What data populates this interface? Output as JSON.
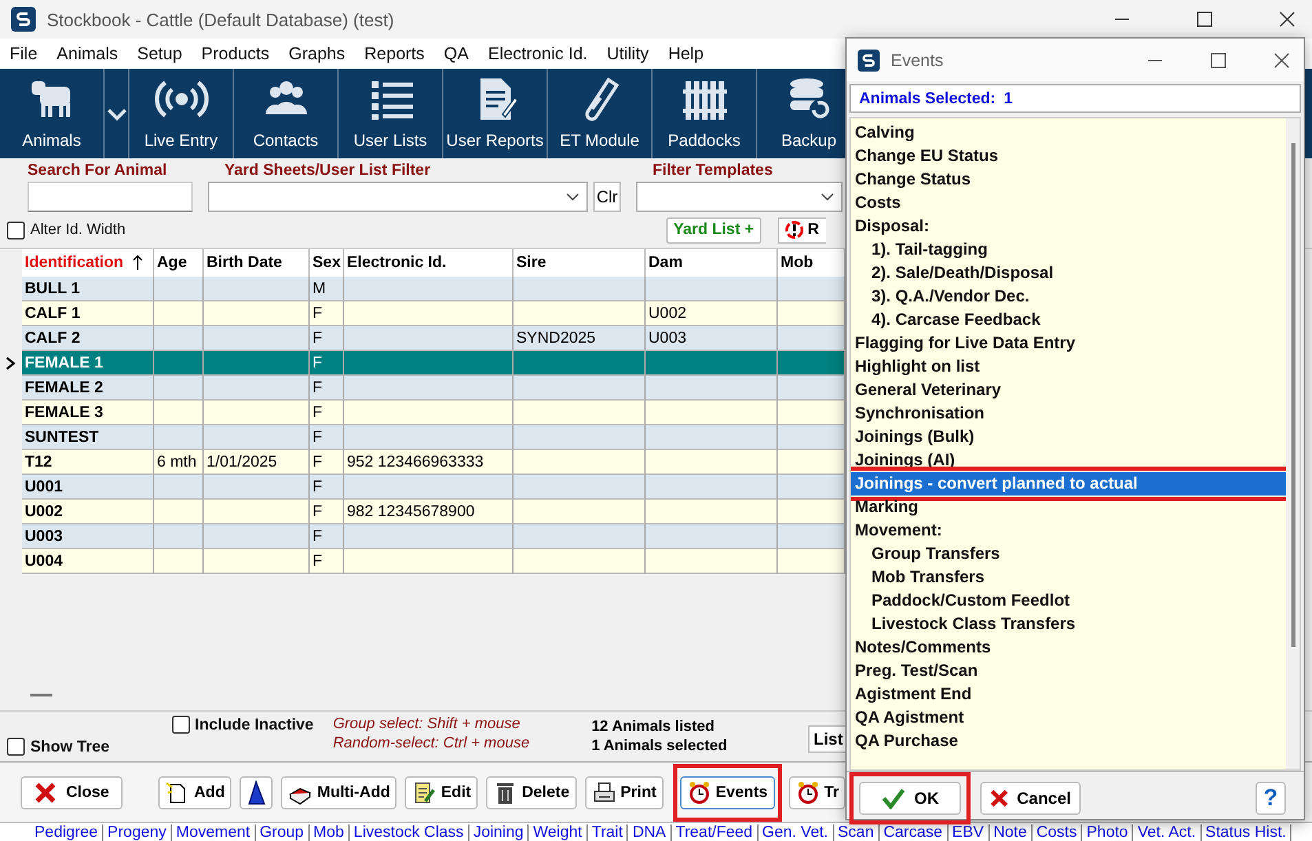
{
  "window": {
    "title": "Stockbook - Cattle (Default Database) (test)"
  },
  "menu": [
    "File",
    "Animals",
    "Setup",
    "Products",
    "Graphs",
    "Reports",
    "QA",
    "Electronic Id.",
    "Utility",
    "Help"
  ],
  "toolbar": [
    {
      "label": "Animals",
      "kind": "cow"
    },
    {
      "label": "Live Entry",
      "kind": "broadcast"
    },
    {
      "label": "Contacts",
      "kind": "people"
    },
    {
      "label": "User Lists",
      "kind": "list"
    },
    {
      "label": "User Reports",
      "kind": "document"
    },
    {
      "label": "ET Module",
      "kind": "tube"
    },
    {
      "label": "Paddocks",
      "kind": "fence"
    },
    {
      "label": "Backup",
      "kind": "database"
    }
  ],
  "filters": {
    "search_label": "Search For Animal",
    "yard_label": "Yard Sheets/User List Filter",
    "clear_button": "Clr",
    "templates_label": "Filter Templates",
    "alter_id_width": {
      "label": "Alter Id. Width",
      "checked": false
    },
    "yard_list_button": "Yard List +",
    "cut_button": "R"
  },
  "table": {
    "columns": [
      {
        "label": "Identification",
        "sorted": true
      },
      {
        "label": "Age",
        "sorted": false
      },
      {
        "label": "Birth Date",
        "sorted": false
      },
      {
        "label": "Sex",
        "sorted": false
      },
      {
        "label": "Electronic Id.",
        "sorted": false
      },
      {
        "label": "Sire",
        "sorted": false
      },
      {
        "label": "Dam",
        "sorted": false
      },
      {
        "label": "Mob",
        "sorted": false
      }
    ],
    "rows": [
      {
        "cells": [
          "BULL 1",
          null,
          null,
          "M",
          null,
          null,
          null,
          null
        ],
        "selected": false
      },
      {
        "cells": [
          "CALF 1",
          null,
          null,
          "F",
          null,
          null,
          "U002",
          null
        ],
        "selected": false
      },
      {
        "cells": [
          "CALF 2",
          null,
          null,
          "F",
          null,
          "SYND2025",
          "U003",
          null
        ],
        "selected": false
      },
      {
        "cells": [
          "FEMALE 1",
          null,
          null,
          "F",
          null,
          null,
          null,
          null
        ],
        "selected": true
      },
      {
        "cells": [
          "FEMALE 2",
          null,
          null,
          "F",
          null,
          null,
          null,
          null
        ],
        "selected": false
      },
      {
        "cells": [
          "FEMALE 3",
          null,
          null,
          "F",
          null,
          null,
          null,
          null
        ],
        "selected": false
      },
      {
        "cells": [
          "SUNTEST",
          null,
          null,
          "F",
          null,
          null,
          null,
          null
        ],
        "selected": false
      },
      {
        "cells": [
          "T12",
          "6 mth",
          "1/01/2025",
          "F",
          "952 123466963333",
          null,
          null,
          null
        ],
        "selected": false
      },
      {
        "cells": [
          "U001",
          null,
          null,
          "F",
          null,
          null,
          null,
          null
        ],
        "selected": false
      },
      {
        "cells": [
          "U002",
          null,
          null,
          "F",
          "982 12345678900",
          null,
          null,
          null
        ],
        "selected": false
      },
      {
        "cells": [
          "U003",
          null,
          null,
          "F",
          null,
          null,
          null,
          null
        ],
        "selected": false
      },
      {
        "cells": [
          "U004",
          null,
          null,
          "F",
          null,
          null,
          null,
          null
        ],
        "selected": false
      }
    ]
  },
  "options": {
    "include_inactive": {
      "label": "Include Inactive",
      "checked": false
    },
    "show_tree": {
      "label": "Show Tree",
      "checked": false
    },
    "hints": [
      "Group select: Shift + mouse",
      "Random-select: Ctrl + mouse"
    ],
    "counts": [
      "12 Animals listed",
      "1 Animals selected"
    ],
    "list_button": "List"
  },
  "buttons": [
    {
      "label": "Close",
      "kind": "close",
      "highlighted": false
    },
    {
      "label": "Add",
      "kind": "add",
      "highlighted": false
    },
    {
      "kind": "cone",
      "highlighted": false
    },
    {
      "label": "Multi-Add",
      "kind": "multi",
      "highlighted": false
    },
    {
      "label": "Edit",
      "kind": "edit",
      "highlighted": false
    },
    {
      "label": "Delete",
      "kind": "delete",
      "highlighted": false
    },
    {
      "label": "Print",
      "kind": "print",
      "highlighted": false
    },
    {
      "label": "Events",
      "kind": "clock",
      "highlighted": true
    },
    {
      "label": "Tr",
      "kind": "clock",
      "highlighted": false
    }
  ],
  "links": [
    "Pedigree",
    "Progeny",
    "Movement",
    "Group",
    "Mob",
    "Livestock Class",
    "Joining",
    "Weight",
    "Trait",
    "DNA",
    "Treat/Feed",
    "Gen. Vet.",
    "Scan",
    "Carcase",
    "EBV",
    "Note",
    "Costs",
    "Photo",
    "Vet. Act.",
    "Status Hist."
  ],
  "events_dialog": {
    "title": "Events",
    "selected_label": "Animals Selected:",
    "selected_count": "1",
    "items": [
      {
        "label": "Calving",
        "selected": false,
        "highlighted": false
      },
      {
        "label": "Change EU Status",
        "selected": false,
        "highlighted": false
      },
      {
        "label": "Change Status",
        "selected": false,
        "highlighted": false
      },
      {
        "label": "Costs",
        "selected": false,
        "highlighted": false
      },
      {
        "label": "Disposal:",
        "selected": false,
        "highlighted": false,
        "children": [
          {
            "label": "1). Tail-tagging",
            "selected": false,
            "highlighted": false
          },
          {
            "label": "2). Sale/Death/Disposal",
            "selected": false,
            "highlighted": false
          },
          {
            "label": "3). Q.A./Vendor Dec.",
            "selected": false,
            "highlighted": false
          },
          {
            "label": "4). Carcase Feedback",
            "selected": false,
            "highlighted": false
          }
        ]
      },
      {
        "label": "Flagging for Live Data Entry",
        "selected": false,
        "highlighted": false
      },
      {
        "label": "Highlight on list",
        "selected": false,
        "highlighted": false
      },
      {
        "label": "General Veterinary",
        "selected": false,
        "highlighted": false
      },
      {
        "label": "Synchronisation",
        "selected": false,
        "highlighted": false
      },
      {
        "label": "Joinings (Bulk)",
        "selected": false,
        "highlighted": false
      },
      {
        "label": "Joinings (AI)",
        "selected": false,
        "highlighted": false
      },
      {
        "label": "Joinings - convert planned to actual",
        "selected": true,
        "highlighted": true
      },
      {
        "label": "Marking",
        "selected": false,
        "highlighted": false
      },
      {
        "label": "Movement:",
        "selected": false,
        "highlighted": false,
        "children": [
          {
            "label": "Group Transfers",
            "selected": false,
            "highlighted": false
          },
          {
            "label": "Mob Transfers",
            "selected": false,
            "highlighted": false
          },
          {
            "label": "Paddock/Custom Feedlot",
            "selected": false,
            "highlighted": false
          },
          {
            "label": "Livestock Class Transfers",
            "selected": false,
            "highlighted": false
          }
        ]
      },
      {
        "label": "Notes/Comments",
        "selected": false,
        "highlighted": false
      },
      {
        "label": "Preg. Test/Scan",
        "selected": false,
        "highlighted": false
      },
      {
        "label": "Agistment End",
        "selected": false,
        "highlighted": false
      },
      {
        "label": "QA Agistment",
        "selected": false,
        "highlighted": false
      },
      {
        "label": "QA Purchase",
        "selected": false,
        "highlighted": false
      }
    ],
    "buttons": [
      {
        "label": "OK",
        "kind": "ok",
        "highlighted": true
      },
      {
        "label": "Cancel",
        "kind": "cancel",
        "highlighted": false
      },
      {
        "label": "?",
        "kind": "help",
        "highlighted": false
      }
    ]
  }
}
